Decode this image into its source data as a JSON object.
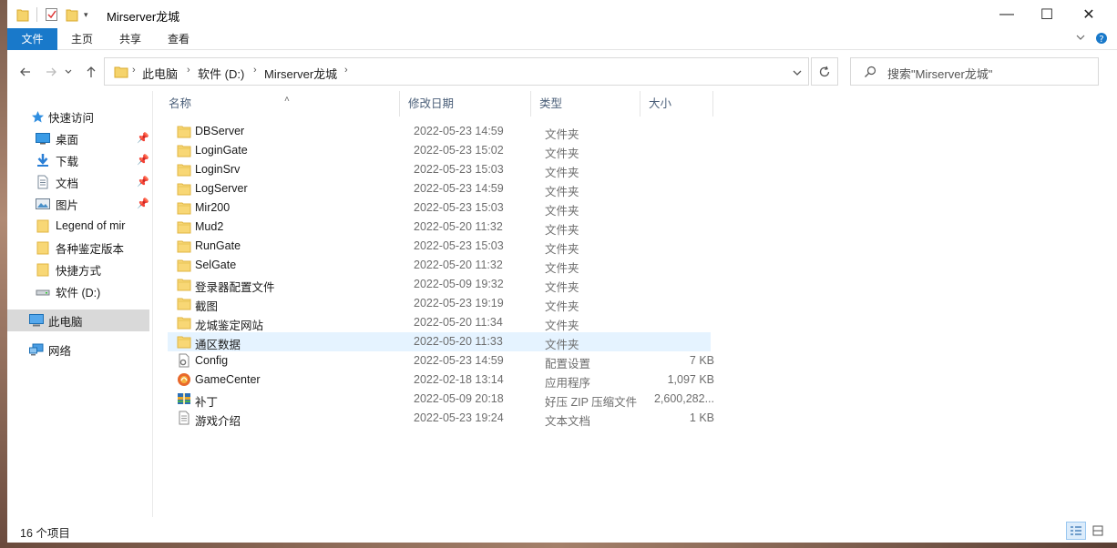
{
  "window": {
    "title": "Mirserver龙城",
    "controls": {
      "minimize": "—",
      "maximize": "☐",
      "close": "✕"
    }
  },
  "ribbon": {
    "tabs": [
      {
        "label": "文件",
        "active": true
      },
      {
        "label": "主页",
        "active": false
      },
      {
        "label": "共享",
        "active": false
      },
      {
        "label": "查看",
        "active": false
      }
    ],
    "accent": "#1979ca"
  },
  "nav": {
    "breadcrumb": [
      "此电脑",
      "软件 (D:)",
      "Mirserver龙城"
    ],
    "search_placeholder": "搜索\"Mirserver龙城\""
  },
  "sidebar": {
    "quick_access": {
      "label": "快速访问",
      "icon": "star-icon"
    },
    "items": [
      {
        "label": "桌面",
        "icon": "desktop-icon",
        "pinned": true
      },
      {
        "label": "下载",
        "icon": "download-icon",
        "pinned": true
      },
      {
        "label": "文档",
        "icon": "document-icon",
        "pinned": true
      },
      {
        "label": "图片",
        "icon": "picture-icon",
        "pinned": true
      },
      {
        "label": "Legend of mir",
        "icon": "folder-icon",
        "pinned": false
      },
      {
        "label": "各种鉴定版本",
        "icon": "folder-icon",
        "pinned": false
      },
      {
        "label": "快捷方式",
        "icon": "folder-icon",
        "pinned": false
      },
      {
        "label": "软件 (D:)",
        "icon": "drive-icon",
        "pinned": false
      }
    ],
    "this_pc": {
      "label": "此电脑",
      "icon": "computer-icon"
    },
    "network": {
      "label": "网络",
      "icon": "network-icon"
    }
  },
  "columns": {
    "name": "名称",
    "date": "修改日期",
    "type": "类型",
    "size": "大小"
  },
  "files": [
    {
      "name": "DBServer",
      "date": "2022-05-23 14:59",
      "type": "文件夹",
      "size": "",
      "icon": "folder"
    },
    {
      "name": "LoginGate",
      "date": "2022-05-23 15:02",
      "type": "文件夹",
      "size": "",
      "icon": "folder"
    },
    {
      "name": "LoginSrv",
      "date": "2022-05-23 15:03",
      "type": "文件夹",
      "size": "",
      "icon": "folder"
    },
    {
      "name": "LogServer",
      "date": "2022-05-23 14:59",
      "type": "文件夹",
      "size": "",
      "icon": "folder"
    },
    {
      "name": "Mir200",
      "date": "2022-05-23 15:03",
      "type": "文件夹",
      "size": "",
      "icon": "folder"
    },
    {
      "name": "Mud2",
      "date": "2022-05-20 11:32",
      "type": "文件夹",
      "size": "",
      "icon": "folder"
    },
    {
      "name": "RunGate",
      "date": "2022-05-23 15:03",
      "type": "文件夹",
      "size": "",
      "icon": "folder"
    },
    {
      "name": "SelGate",
      "date": "2022-05-20 11:32",
      "type": "文件夹",
      "size": "",
      "icon": "folder"
    },
    {
      "name": "登录器配置文件",
      "date": "2022-05-09 19:32",
      "type": "文件夹",
      "size": "",
      "icon": "folder"
    },
    {
      "name": "截图",
      "date": "2022-05-23 19:19",
      "type": "文件夹",
      "size": "",
      "icon": "folder"
    },
    {
      "name": "龙城鉴定网站",
      "date": "2022-05-20 11:34",
      "type": "文件夹",
      "size": "",
      "icon": "folder"
    },
    {
      "name": "通区数据",
      "date": "2022-05-20 11:33",
      "type": "文件夹",
      "size": "",
      "icon": "folder",
      "selected": true
    },
    {
      "name": "Config",
      "date": "2022-05-23 14:59",
      "type": "配置设置",
      "size": "7 KB",
      "icon": "config"
    },
    {
      "name": "GameCenter",
      "date": "2022-02-18 13:14",
      "type": "应用程序",
      "size": "1,097 KB",
      "icon": "app"
    },
    {
      "name": "补丁",
      "date": "2022-05-09 20:18",
      "type": "好压 ZIP 压缩文件",
      "size": "2,600,282...",
      "icon": "zip"
    },
    {
      "name": "游戏介绍",
      "date": "2022-05-23 19:24",
      "type": "文本文档",
      "size": "1 KB",
      "icon": "text"
    }
  ],
  "status": {
    "item_count": "16 个项目"
  }
}
